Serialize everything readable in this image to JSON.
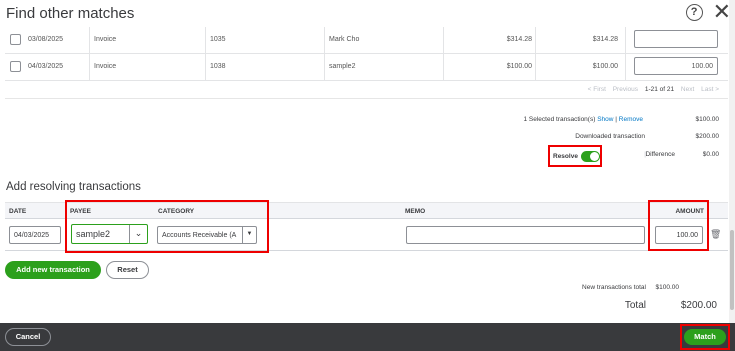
{
  "dialog": {
    "title": "Find other matches",
    "help_glyph": "?",
    "close_glyph": "✕"
  },
  "matches": {
    "rows": [
      {
        "date": "03/08/2025",
        "type": "Invoice",
        "num": "1035",
        "name": "Mark Cho",
        "amount": "$314.28",
        "open": "$314.28",
        "payment": ""
      },
      {
        "date": "04/03/2025",
        "type": "Invoice",
        "num": "1038",
        "name": "sample2",
        "amount": "$100.00",
        "open": "$100.00",
        "payment": "100.00"
      }
    ],
    "pager": {
      "first": "< First",
      "previous": "Previous",
      "range": "1-21 of 21",
      "next": "Next",
      "last": "Last >"
    }
  },
  "summary": {
    "selected_label": "1 Selected transaction(s)",
    "show": "Show",
    "remove": "Remove",
    "selected_amount": "$100.00",
    "downloaded_label": "Downloaded transaction",
    "downloaded_amount": "$200.00",
    "resolve_label": "Resolve",
    "difference_label": "Difference",
    "difference_amount": "$0.00"
  },
  "resolving": {
    "title": "Add resolving transactions",
    "columns": {
      "date": "DATE",
      "payee": "PAYEE",
      "category": "CATEGORY",
      "memo": "MEMO",
      "amount": "AMOUNT"
    },
    "row": {
      "date": "04/03/2025",
      "payee": "sample2",
      "category": "Accounts Receivable (A",
      "memo": "",
      "amount": "100.00"
    },
    "add_button": "Add new transaction",
    "reset_button": "Reset",
    "new_total_label": "New transactions total",
    "new_total_amount": "$100.00",
    "total_label": "Total",
    "total_amount": "$200.00"
  },
  "footer": {
    "cancel": "Cancel",
    "match": "Match"
  },
  "colors": {
    "accent": "#2ca01c",
    "link": "#0077c5",
    "highlight": "#e00000",
    "footer_bg": "#393a3d"
  }
}
